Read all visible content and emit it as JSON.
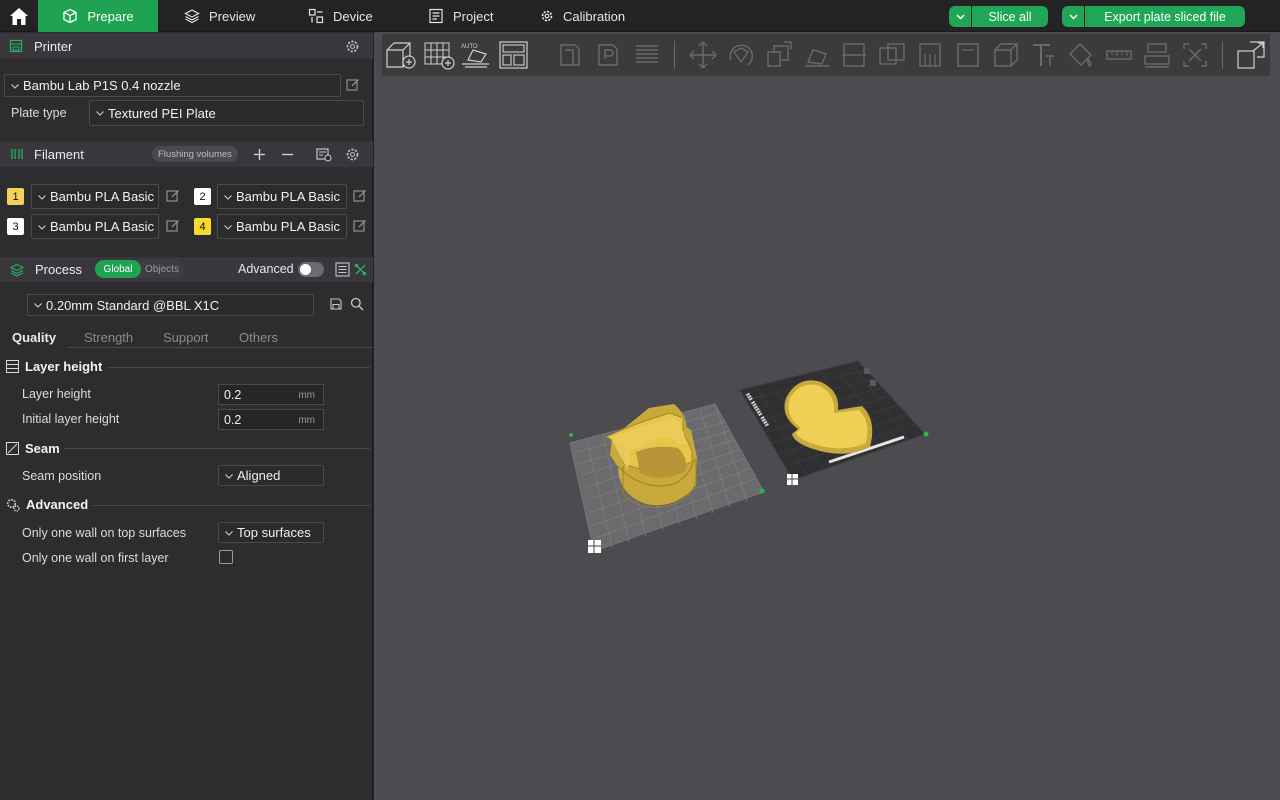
{
  "topbar": {
    "tabs": [
      {
        "label": "Prepare",
        "active": true
      },
      {
        "label": "Preview",
        "active": false
      },
      {
        "label": "Device",
        "active": false
      },
      {
        "label": "Project",
        "active": false
      },
      {
        "label": "Calibration",
        "active": false
      }
    ],
    "slice_all": "Slice all",
    "export": "Export plate sliced file"
  },
  "printer": {
    "title": "Printer",
    "model": "Bambu Lab P1S 0.4 nozzle",
    "plate_type_label": "Plate type",
    "plate_type": "Textured PEI Plate"
  },
  "filament": {
    "title": "Filament",
    "flushing": "Flushing volumes",
    "slots": [
      {
        "num": "1",
        "name": "Bambu PLA Basic",
        "color": "#f3d15a"
      },
      {
        "num": "2",
        "name": "Bambu PLA Basic",
        "color": "#ffffff"
      },
      {
        "num": "3",
        "name": "Bambu PLA Basic",
        "color": "#ffffff"
      },
      {
        "num": "4",
        "name": "Bambu PLA Basic",
        "color": "#f6da2e"
      }
    ]
  },
  "process": {
    "title": "Process",
    "global": "Global",
    "objects": "Objects",
    "advanced": "Advanced",
    "preset": "0.20mm Standard @BBL X1C",
    "tabs": [
      "Quality",
      "Strength",
      "Support",
      "Others"
    ],
    "groups": {
      "layer_height": {
        "title": "Layer height",
        "layer_height_label": "Layer height",
        "layer_height_value": "0.2",
        "initial_label": "Initial layer height",
        "initial_value": "0.2",
        "unit": "mm"
      },
      "seam": {
        "title": "Seam",
        "position_label": "Seam position",
        "position_value": "Aligned"
      },
      "advanced": {
        "title": "Advanced",
        "top_label": "Only one wall on top surfaces",
        "top_value": "Top surfaces",
        "first_label": "Only one wall on first layer"
      }
    }
  },
  "colors": {
    "accent": "#1fa352",
    "part": "#e8c54a"
  }
}
